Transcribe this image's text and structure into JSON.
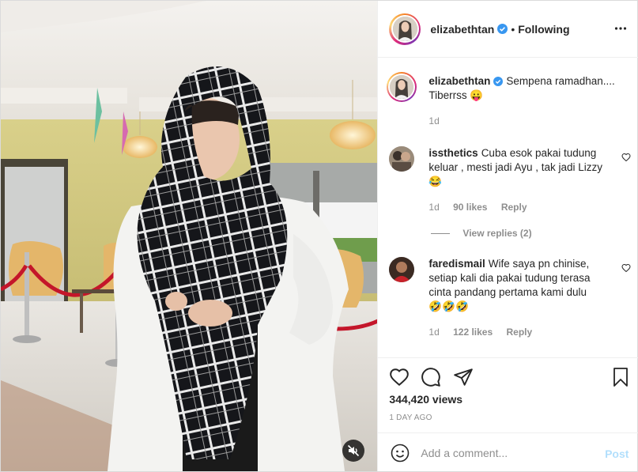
{
  "post": {
    "username": "elizabethtan",
    "following_label": "Following",
    "separator": "•",
    "verified": true
  },
  "caption": {
    "username": "elizabethtan",
    "text": "Sempena ramadhan.... Tiberrss 😛",
    "time": "1d"
  },
  "comments": [
    {
      "username": "issthetics",
      "text": "Cuba esok pakai tudung keluar , mesti jadi Ayu , tak jadi Lizzy 😂",
      "time": "1d",
      "likes": "90 likes",
      "reply_label": "Reply",
      "view_replies": "View replies (2)"
    },
    {
      "username": "faredismail",
      "text": "Wife saya pn chinise, setiap kali dia pakai tudung terasa cinta pandang pertama kami dulu 🤣🤣🤣",
      "time": "1d",
      "likes": "122 likes",
      "reply_label": "Reply"
    }
  ],
  "stats": {
    "views": "344,420 views",
    "posted": "1 DAY AGO"
  },
  "add_comment": {
    "placeholder": "Add a comment...",
    "post_label": "Post"
  },
  "icons": {
    "header": [
      "verified-badge-icon",
      "more-options-icon"
    ],
    "actions": [
      "heart-icon",
      "comment-icon",
      "share-icon",
      "bookmark-icon"
    ],
    "media": [
      "muted-speaker-icon"
    ],
    "composer": [
      "emoji-icon"
    ]
  },
  "colors": {
    "verified": "#3897f0",
    "post_button_disabled": "#b2dffc",
    "muted_text": "#8e8e8e"
  }
}
